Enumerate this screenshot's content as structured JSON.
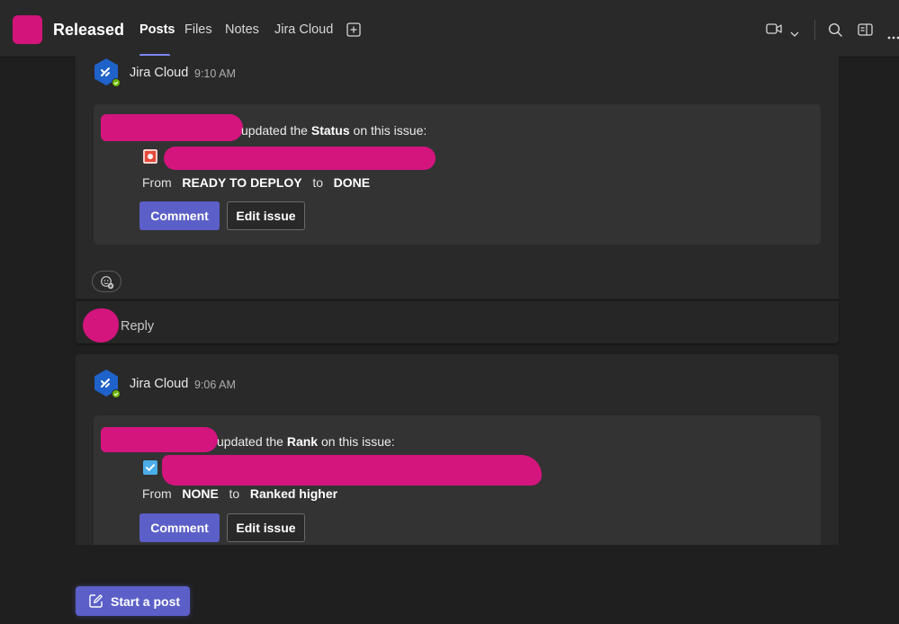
{
  "header": {
    "channel_title": "Released",
    "tabs": [
      {
        "label": "Posts",
        "active": true
      },
      {
        "label": "Files"
      },
      {
        "label": "Notes"
      },
      {
        "label": "Jira Cloud"
      }
    ],
    "team_color": "#d2147b",
    "accent": "#7f85f5"
  },
  "posts": [
    {
      "author": "Jira Cloud",
      "time": "9:10 AM",
      "action_pre": "updated the ",
      "field": "Status",
      "action_post": " on this issue:",
      "from_label": "From",
      "from_value": "READY TO DEPLOY",
      "to_label": "to",
      "to_value": "DONE",
      "icon": "bug-icon",
      "comment_label": "Comment",
      "edit_label": "Edit issue"
    },
    {
      "author": "Jira Cloud",
      "time": "9:06 AM",
      "action_pre": "updated the ",
      "field": "Rank",
      "action_post": " on this issue:",
      "from_label": "From",
      "from_value": "NONE",
      "to_label": "to",
      "to_value": "Ranked higher",
      "icon": "task-icon",
      "comment_label": "Comment",
      "edit_label": "Edit issue"
    }
  ],
  "reply": {
    "label": "Reply"
  },
  "composer": {
    "start_post_label": "Start a post"
  },
  "colors": {
    "primary_button": "#5b5fc7",
    "redaction": "#d4157e",
    "bug": "#e5493a",
    "task": "#4bade8"
  }
}
